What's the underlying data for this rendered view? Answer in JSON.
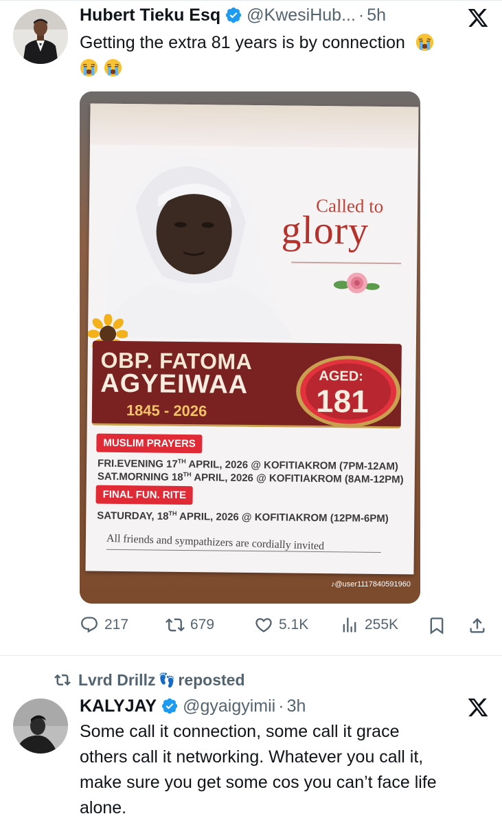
{
  "post1": {
    "author_name": "Hubert Tieku Esq",
    "author_handle": "@KwesiHub...",
    "separator": "·",
    "time": "5h",
    "text": "Getting the extra 81 years is by connection",
    "media": {
      "called_to": "Called to",
      "glory": "glory",
      "name_line1": "OBP. FATOMA",
      "name_line2": "AGYEIWAA",
      "years": "1845 - 2026",
      "aged_label": "AGED:",
      "aged_value": "181",
      "pill_muslim": "MUSLIM PRAYERS",
      "fri_a": "FRI.EVENING 17",
      "fri_sup": "TH",
      "fri_b": " APRIL, 2026 @ KOFITIAKROM (7PM-12AM)",
      "sat_a": "SAT.MORNING 18",
      "sat_sup": "TH",
      "sat_b": " APRIL, 2026 @ KOFITIAKROM (8AM-12PM)",
      "pill_final": "FINAL FUN. RITE",
      "satday_a": "SATURDAY, 18",
      "satday_sup": "TH",
      "satday_b": " APRIL, 2026 @ KOFITIAKROM (12PM-6PM)",
      "invite": "All friends and sympathizers are cordially invited",
      "watermark": "♪@user1117840591960"
    },
    "actions": {
      "replies": "217",
      "reposts": "679",
      "likes": "5.1K",
      "views": "255K"
    }
  },
  "repost_banner": {
    "user": "Lvrd Drillz",
    "feet": "👣",
    "label": "reposted"
  },
  "post2": {
    "author_name": "KALYJAY",
    "author_handle": "@gyaigyimii",
    "separator": "·",
    "time": "3h",
    "text_lines": [
      "Some call it connection, some call it grace",
      "others call it networking. Whatever you call it,",
      "make sure you get some cos you can’t face life",
      "alone."
    ]
  },
  "colors": {
    "verified": "#1d9bf0",
    "secondary_text": "#536471",
    "banner": "#7a2221",
    "pill": "#e02a36"
  }
}
